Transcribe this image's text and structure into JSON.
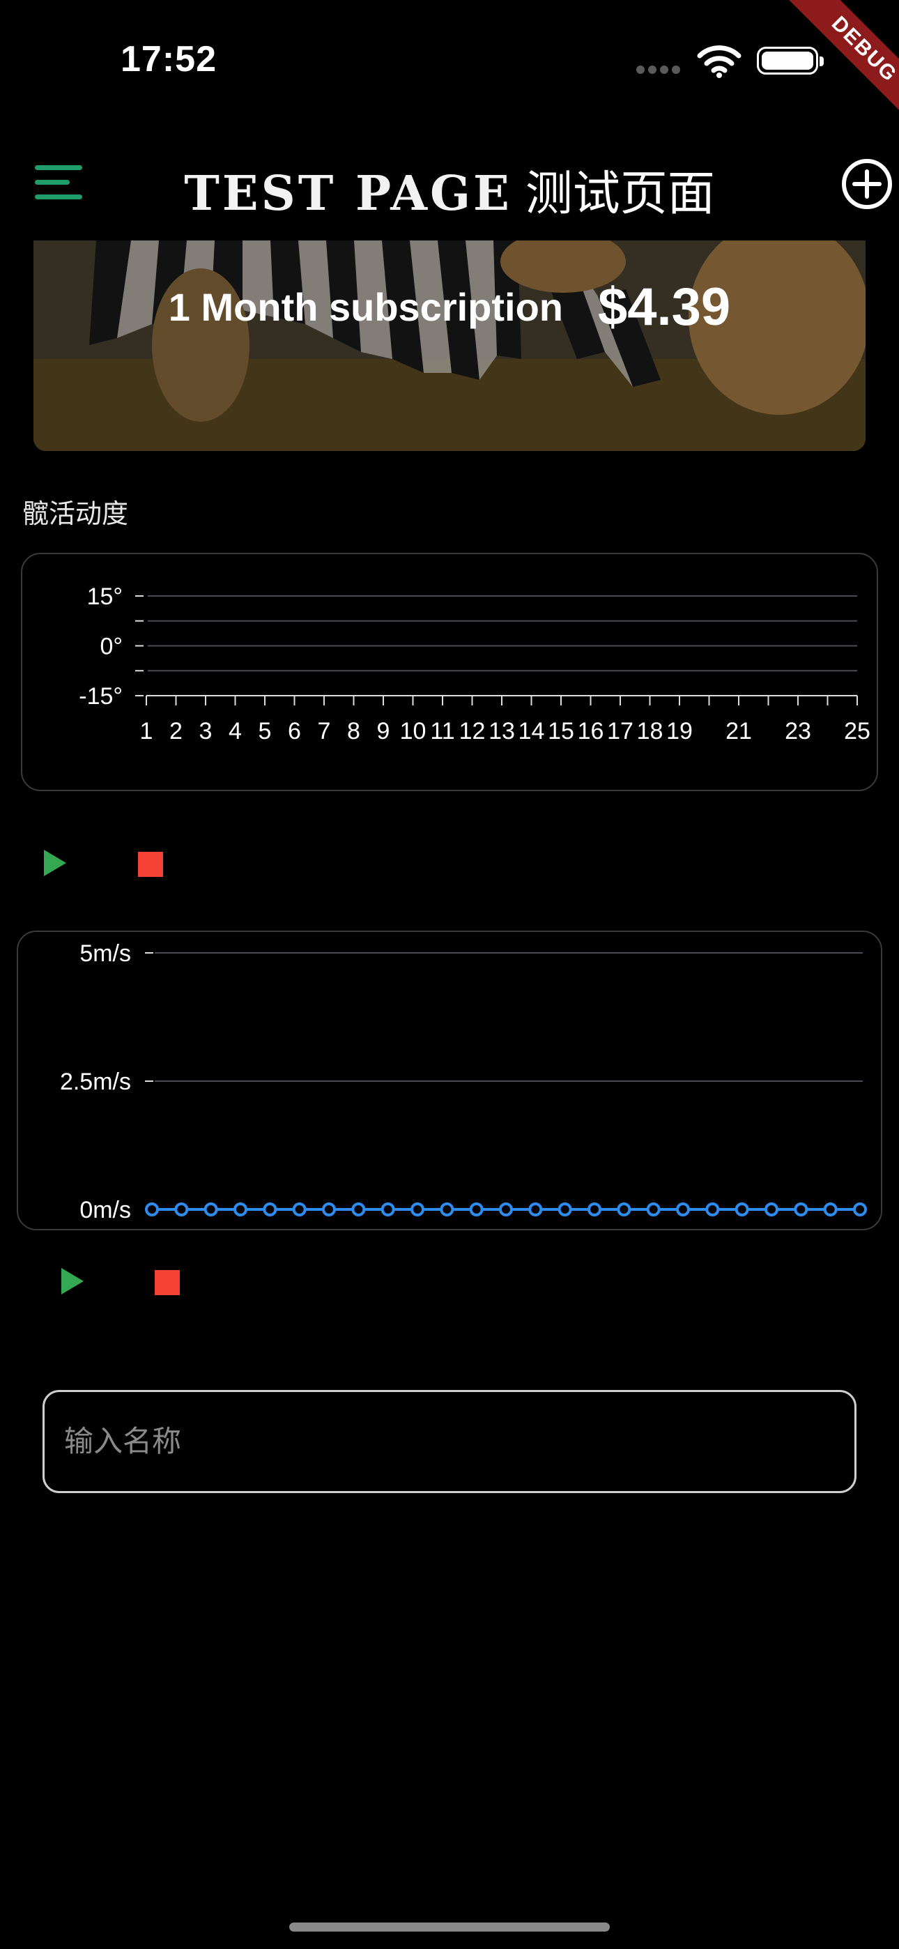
{
  "status_bar": {
    "time": "17:52",
    "debug_badge": "DEBUG"
  },
  "app_bar": {
    "title_latin": "TEST PAGE",
    "title_cjk": "测试页面",
    "menu_icon": "menu-icon",
    "add_icon": "add-circle-icon",
    "accent": "#1f9d6b"
  },
  "banner": {
    "label": "1 Month subscription",
    "price": "$4.39"
  },
  "section": {
    "title": "髋活动度"
  },
  "angle_chart": {
    "y_ticks": [
      "15°",
      "0°",
      "-15°"
    ],
    "x_ticks": [
      "1",
      "2",
      "3",
      "4",
      "5",
      "6",
      "7",
      "8",
      "9",
      "10",
      "11",
      "12",
      "13",
      "14",
      "15",
      "16",
      "17",
      "18",
      "19",
      "21",
      "23",
      "25"
    ]
  },
  "speed_chart": {
    "y_ticks": [
      "5m/s",
      "2.5m/s",
      "0m/s"
    ],
    "line_color": "#2d8cf0"
  },
  "controls": {
    "play_color": "#34a853",
    "stop_color": "#f44336"
  },
  "name_input": {
    "placeholder": "输入名称",
    "value": ""
  },
  "chart_data": [
    {
      "type": "line",
      "title": "",
      "x": [
        1,
        2,
        3,
        4,
        5,
        6,
        7,
        8,
        9,
        10,
        11,
        12,
        13,
        14,
        15,
        16,
        17,
        18,
        19,
        20,
        21,
        22,
        23,
        24,
        25
      ],
      "series": [],
      "xlabel": "",
      "ylabel": "",
      "ylim": [
        -15,
        15
      ],
      "y_ticks": [
        "15°",
        "0°",
        "-15°"
      ],
      "grid": true
    },
    {
      "type": "line",
      "title": "",
      "x": [
        1,
        2,
        3,
        4,
        5,
        6,
        7,
        8,
        9,
        10,
        11,
        12,
        13,
        14,
        15,
        16,
        17,
        18,
        19,
        20,
        21,
        22,
        23,
        24,
        25
      ],
      "series": [
        {
          "values": [
            0,
            0,
            0,
            0,
            0,
            0,
            0,
            0,
            0,
            0,
            0,
            0,
            0,
            0,
            0,
            0,
            0,
            0,
            0,
            0,
            0,
            0,
            0,
            0,
            0
          ]
        }
      ],
      "xlabel": "",
      "ylabel": "",
      "ylim": [
        0,
        5
      ],
      "y_ticks": [
        "5m/s",
        "2.5m/s",
        "0m/s"
      ],
      "grid": true
    }
  ]
}
